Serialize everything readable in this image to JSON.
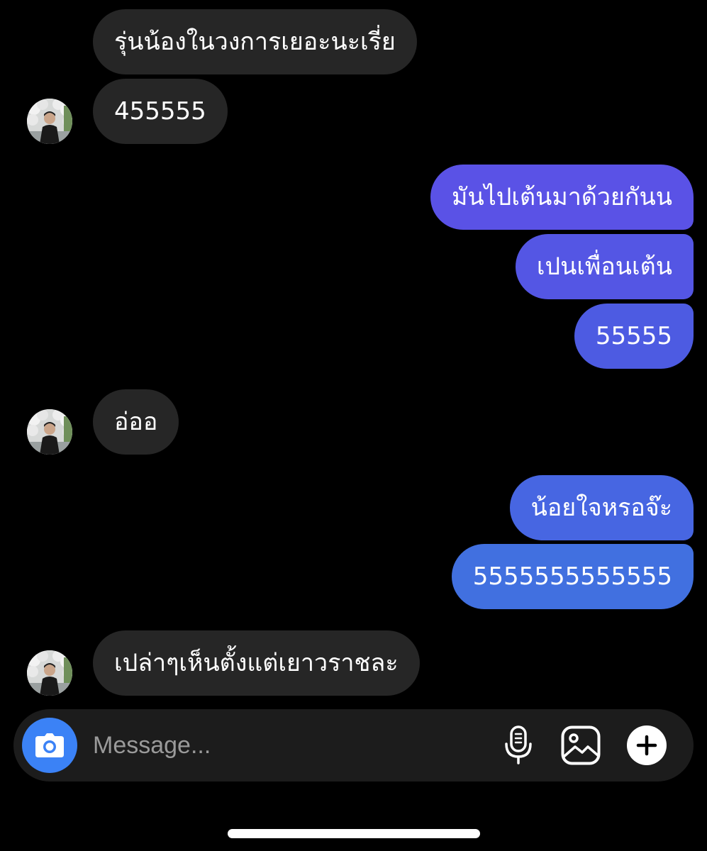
{
  "messages": [
    {
      "side": "in",
      "text": "รุ่นน้องในวงการเยอะนะเรี่ย"
    },
    {
      "side": "in",
      "text": "455555",
      "avatar": "avatar-photo-icon"
    },
    {
      "side": "out",
      "text": "มันไปเต้นมาด้วยกันน"
    },
    {
      "side": "out",
      "text": "เปนเพื่อนเต้น"
    },
    {
      "side": "out",
      "text": "55555"
    },
    {
      "side": "in",
      "text": "อ่ออ",
      "avatar": "avatar-photo-icon"
    },
    {
      "side": "out",
      "text": "น้อยใจหรอจ๊ะ"
    },
    {
      "side": "out",
      "text": "5555555555555"
    },
    {
      "side": "in",
      "text": "เปล่าๆเห็นตั้งแต่เยาวราชละ",
      "avatar": "avatar-photo-icon"
    }
  ],
  "composer": {
    "placeholder": "Message...",
    "icons": [
      "camera-icon",
      "microphone-icon",
      "gallery-icon",
      "plus-icon"
    ]
  },
  "colors": {
    "background": "#000000",
    "incoming_bubble": "#262626",
    "outgoing_gradient_top": "#5b4fe6",
    "outgoing_gradient_bottom": "#3f6fe0",
    "camera_button": "#3b82f6",
    "composer": "#1c1c1c"
  }
}
